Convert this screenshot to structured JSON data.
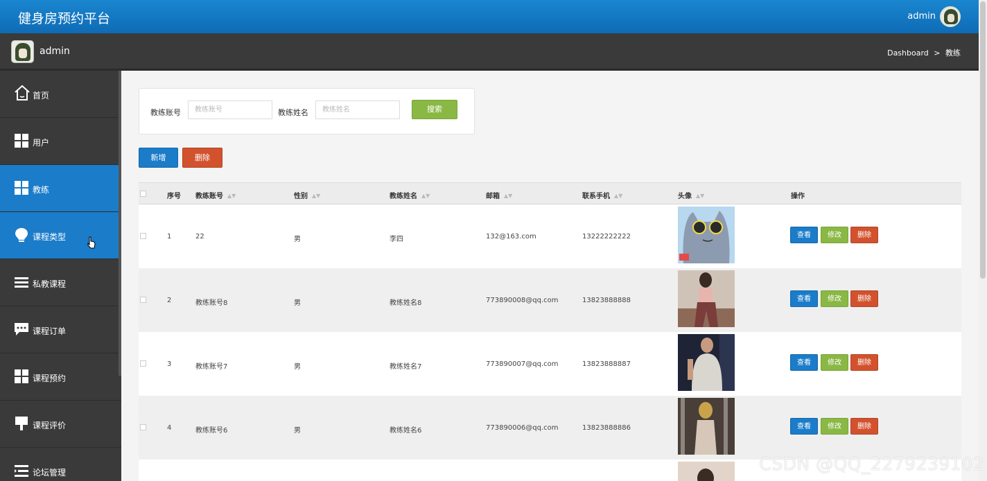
{
  "header": {
    "title": "健身房预约平台",
    "user": "admin"
  },
  "subheader": {
    "user": "admin",
    "breadcrumb_root": "Dashboard",
    "breadcrumb_sep": ">",
    "breadcrumb_current": "教练"
  },
  "sidebar": {
    "items": [
      {
        "label": "首页",
        "icon": "home-icon"
      },
      {
        "label": "用户",
        "icon": "grid-icon"
      },
      {
        "label": "教练",
        "icon": "grid-icon",
        "active": true
      },
      {
        "label": "课程类型",
        "icon": "bulb-icon",
        "hover": true
      },
      {
        "label": "私教课程",
        "icon": "list-icon"
      },
      {
        "label": "课程订单",
        "icon": "chat-icon"
      },
      {
        "label": "课程预约",
        "icon": "grid-icon"
      },
      {
        "label": "课程评价",
        "icon": "sign-icon"
      },
      {
        "label": "论坛管理",
        "icon": "menu-icon"
      }
    ]
  },
  "search": {
    "account_label": "教练账号",
    "account_placeholder": "教练账号",
    "name_label": "教练姓名",
    "name_placeholder": "教练姓名",
    "search_button": "搜索"
  },
  "toolbar": {
    "add_label": "新增",
    "delete_label": "删除"
  },
  "table": {
    "columns": [
      "序号",
      "教练账号",
      "性别",
      "教练姓名",
      "邮箱",
      "联系手机",
      "头像",
      "操作"
    ],
    "rows": [
      {
        "index": "1",
        "account": "22",
        "gender": "男",
        "name": "李四",
        "email": "132@163.com",
        "phone": "13222222222"
      },
      {
        "index": "2",
        "account": "教练账号8",
        "gender": "男",
        "name": "教练姓名8",
        "email": "773890008@qq.com",
        "phone": "13823888888"
      },
      {
        "index": "3",
        "account": "教练账号7",
        "gender": "男",
        "name": "教练姓名7",
        "email": "773890007@qq.com",
        "phone": "13823888887"
      },
      {
        "index": "4",
        "account": "教练账号6",
        "gender": "男",
        "name": "教练姓名6",
        "email": "773890006@qq.com",
        "phone": "13823888886"
      }
    ],
    "actions": {
      "view": "查看",
      "edit": "修改",
      "delete": "删除"
    }
  },
  "watermark": "CSDN @QQ_2279239102",
  "colors": {
    "primary": "#1b7cc9",
    "success": "#8ab845",
    "danger": "#d2522e",
    "sidebar": "#3a3a3a"
  }
}
